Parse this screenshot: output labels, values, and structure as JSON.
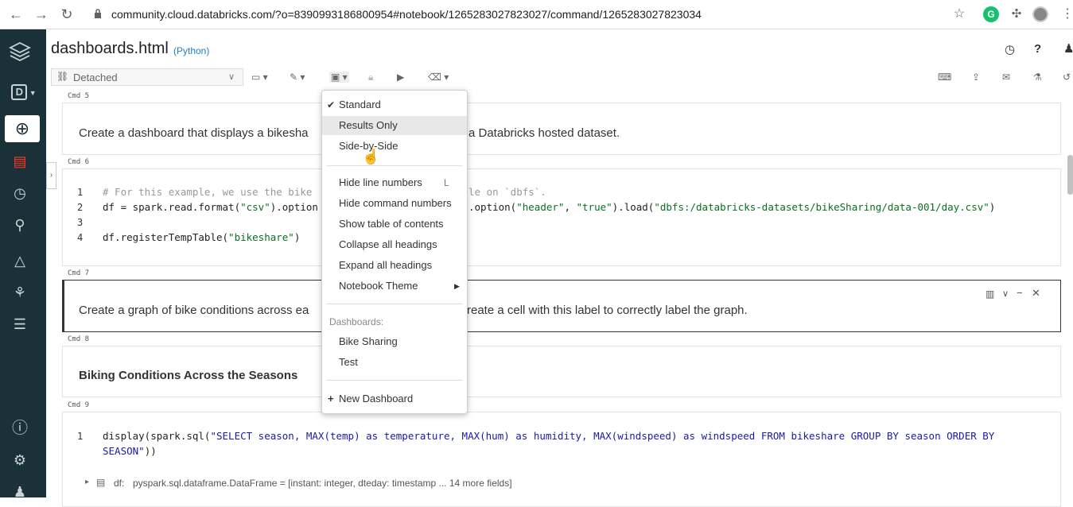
{
  "browser": {
    "url": "community.cloud.databricks.com/?o=8390993186800954#notebook/1265283027823027/command/1265283027823034",
    "back_icon": "arrow-left",
    "forward_icon": "arrow-right",
    "reload_icon": "reload"
  },
  "sidebar": {
    "items": [
      {
        "name": "layers",
        "glyph": "≋"
      },
      {
        "name": "workspace-switcher",
        "glyph": "D"
      },
      {
        "name": "create",
        "glyph": "⊕"
      },
      {
        "name": "notebook",
        "glyph": "▤"
      },
      {
        "name": "recents",
        "glyph": "◷"
      },
      {
        "name": "search",
        "glyph": "⚲"
      },
      {
        "name": "data",
        "glyph": "△"
      },
      {
        "name": "models",
        "glyph": "⚙"
      },
      {
        "name": "jobs",
        "glyph": "☰"
      },
      {
        "name": "help",
        "glyph": "?"
      },
      {
        "name": "settings",
        "glyph": "⚙"
      },
      {
        "name": "user",
        "glyph": "♟"
      }
    ]
  },
  "notebook": {
    "title": "dashboards.html",
    "language": "(Python)",
    "cluster": "Detached"
  },
  "cells": {
    "cmd5": {
      "label": "Cmd 5",
      "text": "Create a dashboard that displays a bikesha"
    },
    "cmd5_tail": "a Databricks hosted dataset.",
    "cmd6": {
      "label": "Cmd 6",
      "lines": [
        "1",
        "2",
        "3",
        "4"
      ],
      "code1": "# For this example, we use the bike",
      "code1_tail": "le on `dbfs`.",
      "code2a": "df = spark.read.format(",
      "code2b": "\"csv\"",
      "code2c": ").option",
      "code2d": ".option(",
      "code2e": "\"header\"",
      "code2f": ", ",
      "code2g": "\"true\"",
      "code2h": ").load(",
      "code2i": "\"dbfs:/databricks-datasets/bikeSharing/data-001/day.csv\"",
      "code2j": ")",
      "code4a": "df.registerTempTable(",
      "code4b": "\"bikeshare\"",
      "code4c": ")"
    },
    "cmd7": {
      "label": "Cmd 7",
      "text": "Create a graph of bike conditions across ea",
      "tail": "reate a cell with this label to correctly label the graph."
    },
    "cmd8": {
      "label": "Cmd 8",
      "heading": "Biking Conditions Across the Seasons"
    },
    "cmd9": {
      "label": "Cmd 9",
      "line": "1",
      "code_a": "display(spark.sql(",
      "code_b": "\"SELECT season, MAX(temp) as temperature, MAX(hum) as humidity, MAX(windspeed) as windspeed FROM bikeshare GROUP BY season ORDER BY",
      "code_c": "SEASON\"",
      "code_d": "))",
      "df_label": "df:",
      "df_schema": "pyspark.sql.dataframe.DataFrame = [instant: integer, dteday: timestamp ... 14 more fields]"
    }
  },
  "menu": {
    "view_options": [
      "Standard",
      "Results Only",
      "Side-by-Side"
    ],
    "selected": "Standard",
    "settings": [
      "Hide line numbers",
      "Hide command numbers",
      "Show table of contents",
      "Collapse all headings",
      "Expand all headings",
      "Notebook Theme"
    ],
    "shortcut_hide_line_numbers": "L",
    "dashboards_header": "Dashboards:",
    "dashboards": [
      "Bike Sharing",
      "Test"
    ],
    "new_dashboard": "New Dashboard"
  }
}
